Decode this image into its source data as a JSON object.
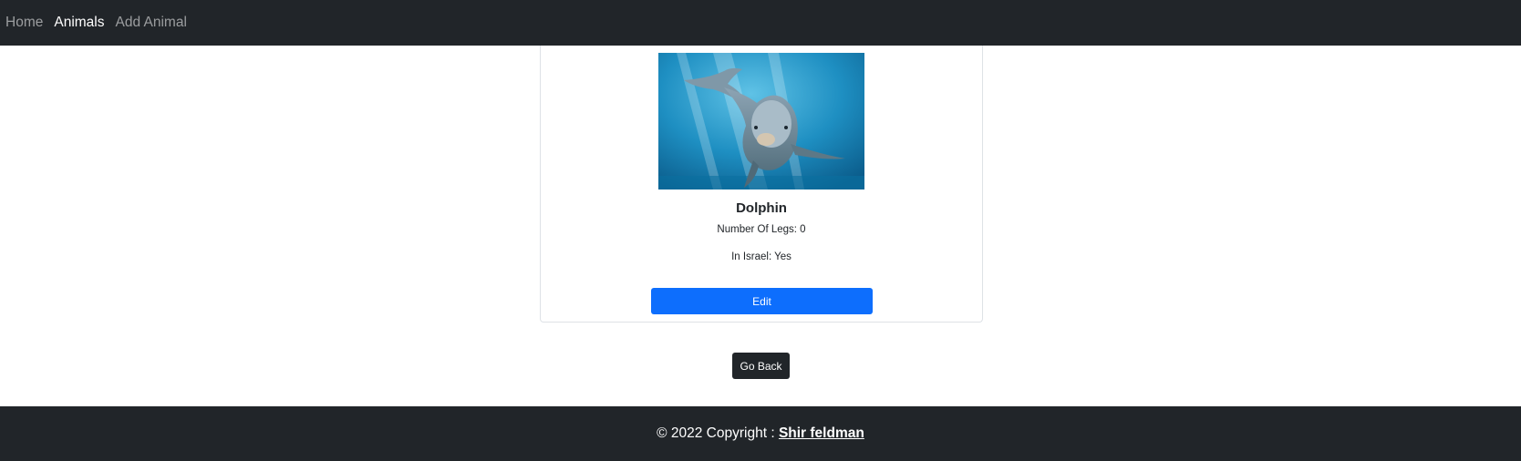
{
  "navbar": {
    "links": [
      {
        "label": "Home",
        "active": false
      },
      {
        "label": "Animals",
        "active": true
      },
      {
        "label": "Add Animal",
        "active": false
      }
    ]
  },
  "card": {
    "image_alt": "Dolphin",
    "title": "Dolphin",
    "legs_text": "Number Of Legs: 0",
    "israel_text": "In Israel: Yes",
    "edit_label": "Edit"
  },
  "back_label": "Go Back",
  "footer": {
    "prefix": "© 2022 Copyright : ",
    "author": "Shir feldman"
  },
  "colors": {
    "navbar_bg": "#212529",
    "primary": "#0d6efd",
    "dark": "#212529"
  }
}
